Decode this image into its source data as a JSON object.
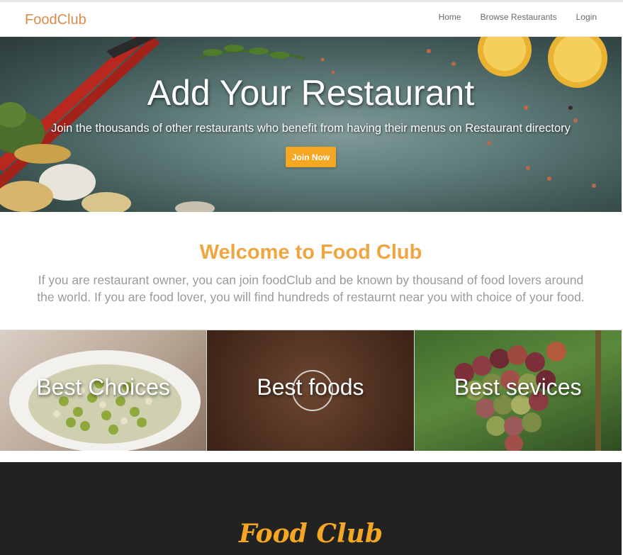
{
  "navbar": {
    "brand": "FoodClub",
    "links": [
      {
        "label": "Home"
      },
      {
        "label": "Browse Restaurants"
      },
      {
        "label": "Login"
      }
    ]
  },
  "hero": {
    "title": "Add Your Restaurant",
    "subtitle": "Join the thousands of other restaurants who benefit from having their menus on Restaurant directory",
    "button_label": "Join Now"
  },
  "welcome": {
    "title": "Welcome to Food Club",
    "text": "If you are restaurant owner, you can join foodClub and be known by thousand of food lovers around the world. If you are food lover, you will find hundreds of restaurnt near you with choice of your food."
  },
  "tiles": [
    {
      "label": "Best Choices"
    },
    {
      "label": "Best foods"
    },
    {
      "label": "Best sevices"
    }
  ],
  "footer": {
    "brand": "Food Club"
  },
  "colors": {
    "brand": "#d98c4a",
    "accent": "#f5a623",
    "welcome_title": "#f0a640",
    "footer_bg": "#222222"
  }
}
